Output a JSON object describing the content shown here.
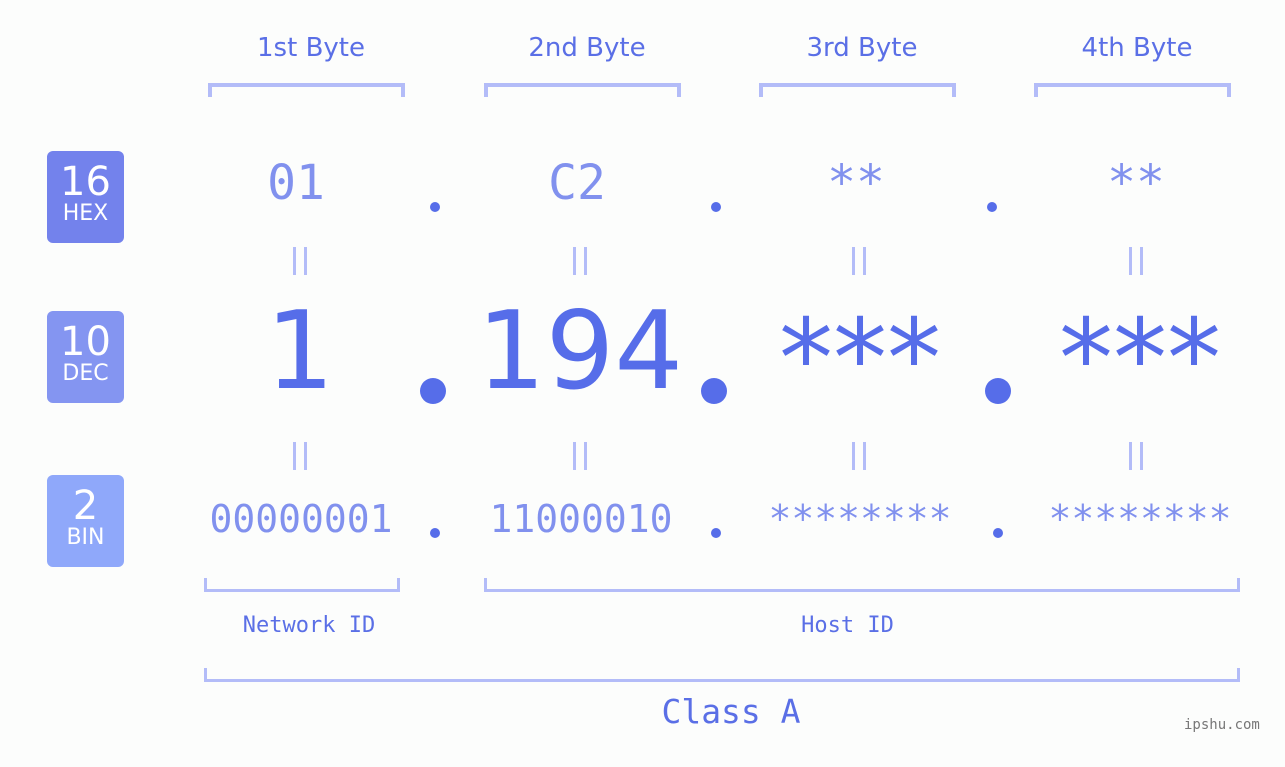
{
  "bytes": {
    "headers": [
      "1st Byte",
      "2nd Byte",
      "3rd Byte",
      "4th Byte"
    ]
  },
  "badges": {
    "hex": {
      "number": "16",
      "label": "HEX",
      "color": "#7382ec"
    },
    "dec": {
      "number": "10",
      "label": "DEC",
      "color": "#8495f1"
    },
    "bin": {
      "number": "2",
      "label": "BIN",
      "color": "#8fa8fa"
    }
  },
  "ip": {
    "hex": [
      "01",
      "C2",
      "**",
      "**"
    ],
    "dec": [
      "1",
      "194",
      "***",
      "***"
    ],
    "bin": [
      "00000001",
      "11000010",
      "********",
      "********"
    ]
  },
  "segments": {
    "network_id": "Network ID",
    "host_id": "Host ID",
    "class": "Class A"
  },
  "colors": {
    "accent": "#566de9",
    "light_accent": "#8191ee",
    "bracket": "#b3bcf8",
    "background": "#fcfdfc"
  },
  "watermark": "ipshu.com"
}
